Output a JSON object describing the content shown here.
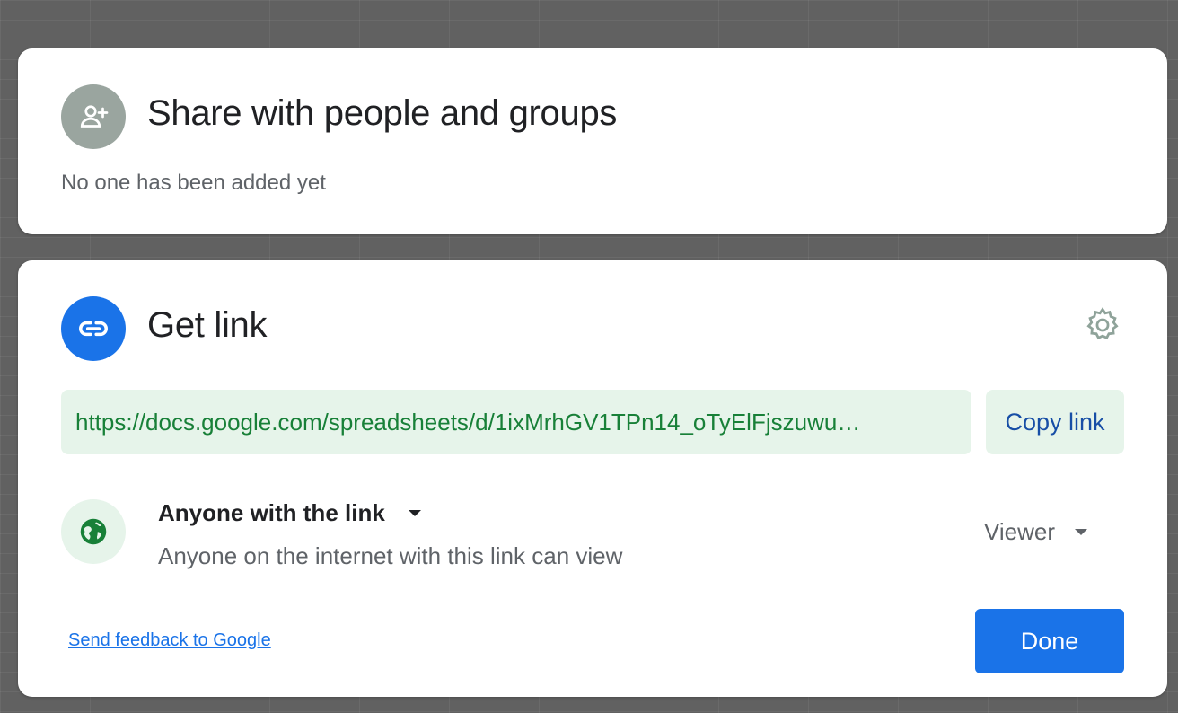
{
  "share_section": {
    "title": "Share with people and groups",
    "empty_note": "No one has been added yet",
    "icon": "person-add-icon"
  },
  "link_section": {
    "title": "Get link",
    "icon": "link-icon",
    "settings_icon": "gear-icon",
    "url": "https://docs.google.com/spreadsheets/d/1ixMrhGV1TPn14_oTyElFjszuwu…",
    "copy_label": "Copy link",
    "access": {
      "icon": "globe-icon",
      "selected": "Anyone with the link",
      "description": "Anyone on the internet with this link can view"
    },
    "role": {
      "selected": "Viewer"
    }
  },
  "footer": {
    "feedback_label": "Send feedback to Google",
    "done_label": "Done"
  },
  "colors": {
    "accent": "#1a73e8",
    "link_green": "#188038",
    "link_bg": "#e6f4ea",
    "backdrop": "#616161"
  }
}
